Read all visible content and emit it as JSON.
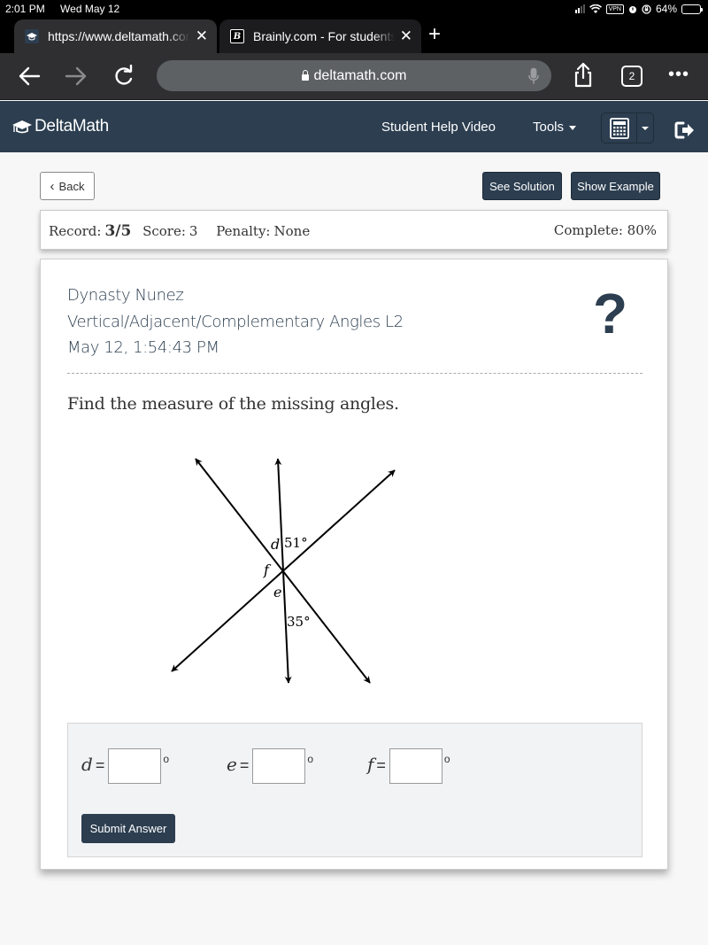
{
  "status_bar": {
    "time": "2:01 PM",
    "date": "Wed May 12",
    "vpn_label": "VPN",
    "battery": "64%",
    "battery_level": 0.64
  },
  "browser": {
    "tabs": [
      {
        "title": "https://www.deltamath.com",
        "favicon": "graduation-cap-icon",
        "active": true
      },
      {
        "title": "Brainly.com - For students",
        "favicon": "brainly-b-icon",
        "active": false
      }
    ],
    "close_glyph": "✕",
    "new_tab_glyph": "+",
    "url": "deltamath.com",
    "tab_count": "2",
    "more_glyph": "•••"
  },
  "app_header": {
    "brand": "DeltaMath",
    "help_video": "Student Help Video",
    "tools": "Tools"
  },
  "actions": {
    "back": "Back",
    "see_solution": "See Solution",
    "show_example": "Show Example"
  },
  "record": {
    "record_label": "Record:",
    "record_value": "3/5",
    "score_label": "Score:",
    "score_value": "3",
    "penalty_label": "Penalty:",
    "penalty_value": "None",
    "complete_label": "Complete:",
    "complete_value": "80%"
  },
  "problem": {
    "student_name": "Dynasty Nunez",
    "assignment": "Vertical/Adjacent/Complementary Angles L2",
    "timestamp": "May 12, 1:54:43 PM",
    "help_glyph": "?",
    "prompt": "Find the measure of the missing angles.",
    "diagram": {
      "labels": {
        "d": "d",
        "f": "f",
        "e": "e",
        "given_top": "51°",
        "given_bottom": "35°"
      }
    }
  },
  "answers": {
    "fields": [
      {
        "var": "d",
        "eq": "=",
        "value": "",
        "unit": "o"
      },
      {
        "var": "e",
        "eq": "=",
        "value": "",
        "unit": "o"
      },
      {
        "var": "f",
        "eq": "=",
        "value": "",
        "unit": "o"
      }
    ],
    "submit": "Submit Answer"
  }
}
